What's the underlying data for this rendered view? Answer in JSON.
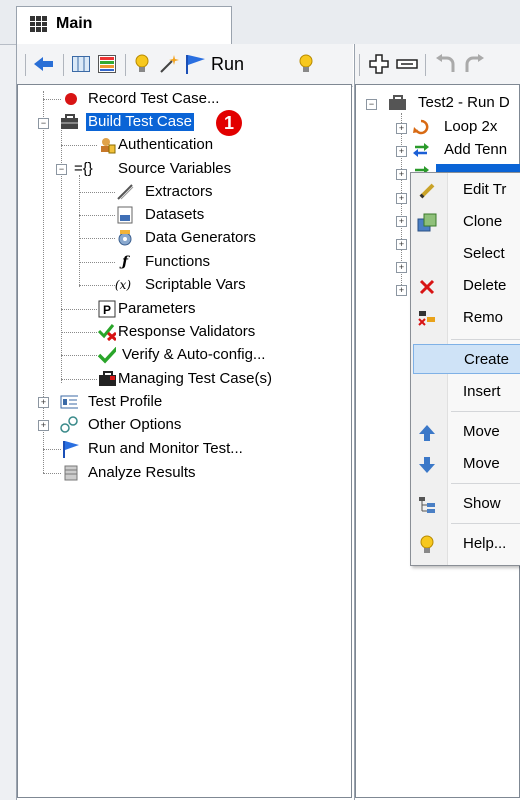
{
  "window": {
    "tab_title": "Main"
  },
  "left_toolbar": {
    "run_label": "Run"
  },
  "left_tree": {
    "items": [
      {
        "label": "Record Test Case..."
      },
      {
        "label": "Build Test Case",
        "selected": true
      },
      {
        "label": "Authentication"
      },
      {
        "label": "Source Variables"
      },
      {
        "label": "Extractors"
      },
      {
        "label": "Datasets"
      },
      {
        "label": "Data Generators"
      },
      {
        "label": "Functions"
      },
      {
        "label": "Scriptable Vars"
      },
      {
        "label": "Parameters"
      },
      {
        "label": "Response Validators"
      },
      {
        "label": "Verify & Auto-config..."
      },
      {
        "label": "Managing Test Case(s)"
      },
      {
        "label": "Test Profile"
      },
      {
        "label": "Other Options"
      },
      {
        "label": "Run and Monitor Test..."
      },
      {
        "label": "Analyze Results"
      }
    ],
    "badge": "1",
    "source_vars_prefix": "={}"
  },
  "right_tree": {
    "items": [
      {
        "label": "Test2 - Run D"
      },
      {
        "label": "Loop 2x"
      },
      {
        "label": "Add Tenn"
      }
    ]
  },
  "context_menu": {
    "items": [
      {
        "label": "Edit Tr"
      },
      {
        "label": "Clone"
      },
      {
        "label": "Select"
      },
      {
        "label": "Delete"
      },
      {
        "label": "Remo"
      },
      {
        "label": "Create",
        "highlighted": true
      },
      {
        "label": "Insert"
      },
      {
        "label": "Move"
      },
      {
        "label": "Move"
      },
      {
        "label": "Show"
      },
      {
        "label": "Help..."
      }
    ]
  },
  "colors": {
    "selection": "#0a64d6",
    "menu_highlight": "#cfe3f7",
    "badge": "#e20000"
  }
}
